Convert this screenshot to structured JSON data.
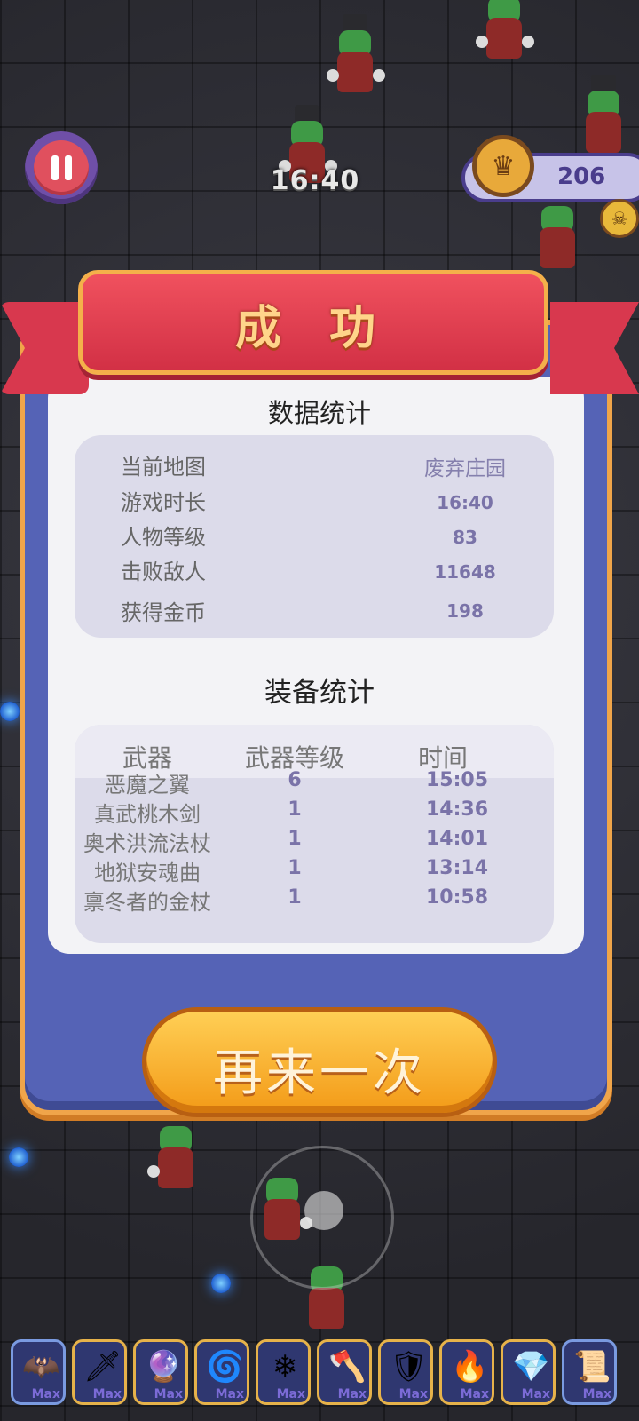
{
  "hud": {
    "timer": "16:40",
    "coins": "206"
  },
  "dialog": {
    "title": "成 功",
    "stats_title": "数据统计",
    "stats": [
      {
        "label": "当前地图",
        "value": "废弃庄园"
      },
      {
        "label": "游戏时长",
        "value": "16:40"
      },
      {
        "label": "人物等级",
        "value": "83"
      },
      {
        "label": "击败敌人",
        "value": "11648"
      },
      {
        "label": "获得金币",
        "value": "198"
      }
    ],
    "equip_title": "装备统计",
    "equip_headers": {
      "weapon": "武器",
      "level": "武器等级",
      "time": "时间"
    },
    "equipment": [
      {
        "name": "恶魔之翼",
        "level": "6",
        "time": "15:05"
      },
      {
        "name": "真武桃木剑",
        "level": "1",
        "time": "14:36"
      },
      {
        "name": "奥术洪流法杖",
        "level": "1",
        "time": "14:01"
      },
      {
        "name": "地狱安魂曲",
        "level": "1",
        "time": "13:14"
      },
      {
        "name": "禀冬者的金杖",
        "level": "1",
        "time": "10:58"
      }
    ],
    "retry_label": "再来一次"
  },
  "weapon_bar": [
    {
      "icon": "demon-wings-icon",
      "glyph": "🦇",
      "badge": "Max"
    },
    {
      "icon": "peach-sword-icon",
      "glyph": "🗡",
      "badge": "Max"
    },
    {
      "icon": "arcane-staff-icon",
      "glyph": "🔮",
      "badge": "Max"
    },
    {
      "icon": "hell-requiem-icon",
      "glyph": "🌀",
      "badge": "Max"
    },
    {
      "icon": "frost-scepter-icon",
      "glyph": "❄",
      "badge": "Max"
    },
    {
      "icon": "axe-icon",
      "glyph": "🪓",
      "badge": "Max"
    },
    {
      "icon": "shield-icon",
      "glyph": "🛡",
      "badge": "Max"
    },
    {
      "icon": "torch-icon",
      "glyph": "🔥",
      "badge": "Max"
    },
    {
      "icon": "crystal-icon",
      "glyph": "💎",
      "badge": "Max"
    },
    {
      "icon": "scroll-icon",
      "glyph": "📜",
      "badge": "Max"
    }
  ]
}
